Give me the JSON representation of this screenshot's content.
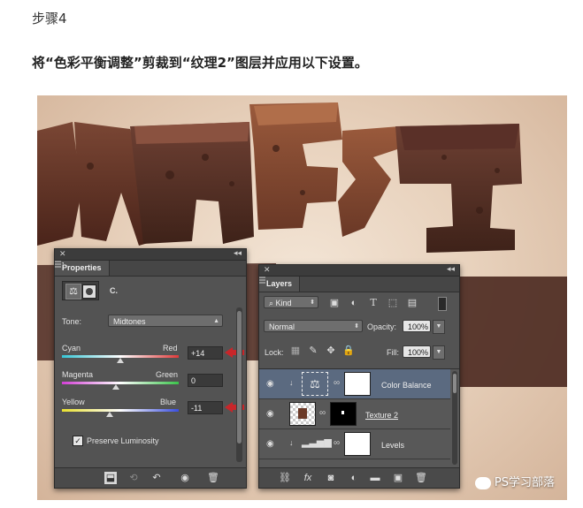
{
  "step_title": "步骤4",
  "instruction": "将“色彩平衡调整”剪裁到“纹理2”图层并应用以下设置。",
  "properties": {
    "tab": "Properties",
    "header_label": "C.",
    "tone_label": "Tone:",
    "tone_value": "Midtones",
    "sliders": [
      {
        "left": "Cyan",
        "right": "Red",
        "value": "+14",
        "pos": 0.57
      },
      {
        "left": "Magenta",
        "right": "Green",
        "value": "0",
        "pos": 0.5
      },
      {
        "left": "Yellow",
        "right": "Blue",
        "value": "-11",
        "pos": 0.44
      }
    ],
    "preserve_label": "Preserve Luminosity",
    "preserve_checked": true
  },
  "layers": {
    "tab": "Layers",
    "filter_kind": "Kind",
    "blend_mode": "Normal",
    "opacity_label": "Opacity:",
    "opacity_value": "100%",
    "lock_label": "Lock:",
    "fill_label": "Fill:",
    "fill_value": "100%",
    "rows": [
      {
        "name": "Color Balance",
        "selected": true
      },
      {
        "name": "Texture 2",
        "selected": false
      },
      {
        "name": "Levels",
        "selected": false
      }
    ]
  },
  "watermark": "PS学习部落",
  "colors": {
    "arrow": "#c8262a",
    "panel": "#535353",
    "selected_row": "#5b6a80"
  }
}
